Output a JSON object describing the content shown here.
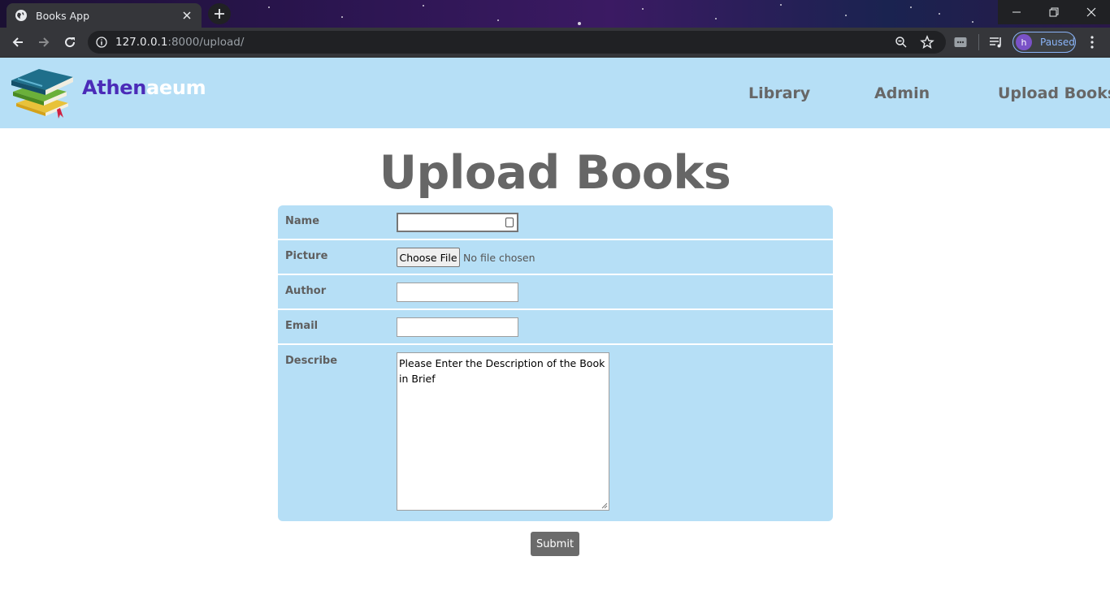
{
  "browser": {
    "tab_title": "Books App",
    "url_host": "127.0.0.1",
    "url_rest": ":8000/upload/",
    "profile_initial": "h",
    "profile_status": "Paused"
  },
  "navbar": {
    "brand_part1": "Athen",
    "brand_part2": "aeum",
    "links": [
      "Library",
      "Admin",
      "Upload Books"
    ]
  },
  "page": {
    "title": "Upload Books"
  },
  "form": {
    "name_label": "Name",
    "name_value": "",
    "picture_label": "Picture",
    "choose_file_label": "Choose File",
    "no_file_text": "No file chosen",
    "author_label": "Author",
    "author_value": "",
    "email_label": "Email",
    "email_value": "",
    "describe_label": "Describe",
    "describe_value": "Please Enter the Description of the Book in Brief",
    "submit_label": "Submit"
  },
  "colors": {
    "navbar_bg": "#b6dff6",
    "brand_dark": "#4b2bb8",
    "brand_light": "#ffffff",
    "nav_text": "#676767",
    "submit_bg": "#6b6b6b"
  }
}
